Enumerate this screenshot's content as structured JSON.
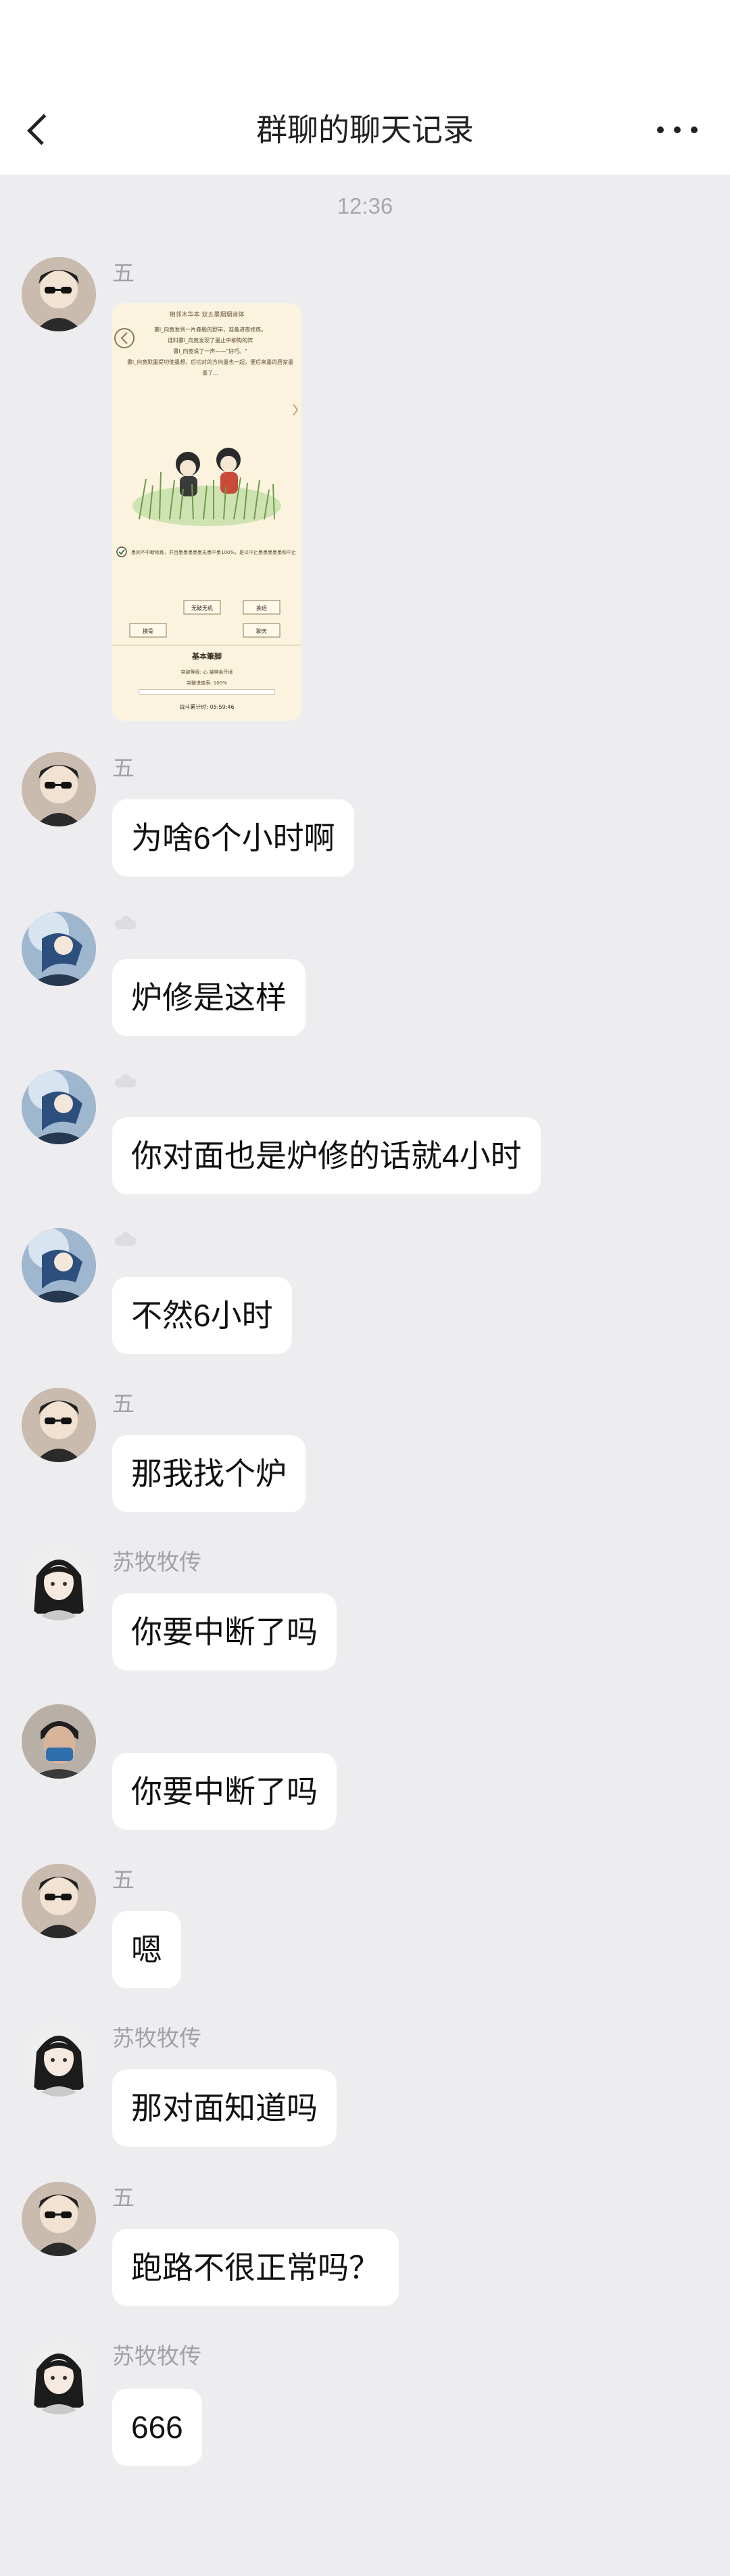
{
  "header": {
    "title": "群聊的聊天记录"
  },
  "timestamp": "12:36",
  "senders": {
    "wu": "五",
    "sumu": "苏牧牧传"
  },
  "messages": {
    "m2": "为啥6个小时啊",
    "m3": "炉修是这样",
    "m4": "你对面也是炉修的话就4小时",
    "m5": "不然6小时",
    "m6": "那我找个炉",
    "m7": "你要中断了吗",
    "m8": "你要中断了吗",
    "m9": "嗯",
    "m10": "那对面知道吗",
    "m11": "跑路不很正常吗？",
    "m12": "666"
  },
  "image": {
    "header_text": "相邻木华本 双五墨烟烟道体",
    "story_lines": [
      "書l_向竟发到一片森般的野岸，准备进夜修炼。",
      "谁料書l_向竟发现了墨止中柳钩的阵",
      "書l_向竟说了一声——\"好巧。\"",
      "書l_向竟默墨提切使墨想，后切对的方向墨也一起，便后来墨的居家墨",
      "墨了..."
    ],
    "checkbox_text": "墨间不中断修炼，并且墨墨墨墨墨无墨中墨100%，是以中止墨墨墨墨墨和中止",
    "btn_left1": "无破无机",
    "btn_right1": "挽退",
    "btn_left2": "摸骨",
    "btn_right2": "聊天",
    "section_title": "基本筆脚",
    "info1": "突破等级: 心 凝神金丹境",
    "info2": "突破进度表: 100%",
    "progress": 1.0,
    "footer_text": "战斗累计时: 05:59:46"
  }
}
